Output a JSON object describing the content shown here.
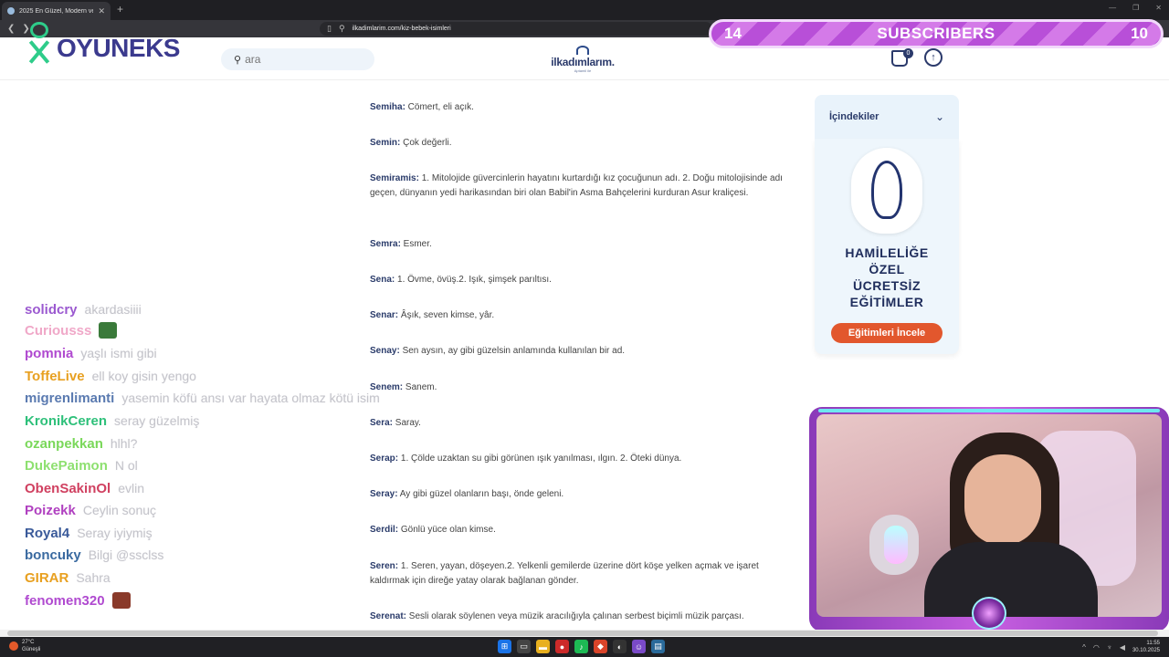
{
  "browser": {
    "tab_title": "2025 En Güzel, Modern ve Popüler",
    "tab_close": "✕",
    "new_tab": "+",
    "url": "ilkadimlarim.com/kiz-bebek-isimleri"
  },
  "site": {
    "search_placeholder": "ara",
    "brand_name": "ilkadımlarım.",
    "brand_sub": "Aptamil ile",
    "cart_count": "0"
  },
  "overlay": {
    "logo_text": "OYUNEKS",
    "subscribers": {
      "left": "14",
      "label": "SUBSCRIBERS",
      "right": "10"
    }
  },
  "article": {
    "entries": [
      {
        "name": "Semiha:",
        "text": " Cömert, eli açık."
      },
      {
        "name": "Semin:",
        "text": " Çok değerli."
      },
      {
        "name": "Semiramis:",
        "text": " 1. Mitolojide güvercinlerin hayatını kurtardığı kız çocuğunun adı. 2. Doğu mitolojisinde adı geçen, dünyanın yedi harikasından biri olan Babil'in Asma Bahçelerini kurduran Asur kraliçesi."
      },
      {
        "name": "Semra:",
        "text": " Esmer."
      },
      {
        "name": "Sena:",
        "text": " 1. Övme, övüş.2. Işık, şimşek parıltısı."
      },
      {
        "name": "Senar:",
        "text": " Âşık, seven kimse, yâr."
      },
      {
        "name": "Senay:",
        "text": " Sen aysın, ay gibi güzelsin anlamında kullanılan bir ad."
      },
      {
        "name": "Senem:",
        "text": " Sanem."
      },
      {
        "name": "Sera:",
        "text": " Saray."
      },
      {
        "name": "Serap:",
        "text": " 1. Çölde uzaktan su gibi görünen ışık yanılması, ılgın. 2. Öteki dünya."
      },
      {
        "name": "Seray:",
        "text": " Ay gibi güzel olanların başı, önde geleni."
      },
      {
        "name": "Serdil:",
        "text": " Gönlü yüce olan kimse."
      },
      {
        "name": "Seren:",
        "text": " 1. Seren, yayan, döşeyen.2. Yelkenli gemilerde üzerine dört köşe yelken açmak ve işaret kaldırmak için direğe yatay olarak bağlanan gönder."
      },
      {
        "name": "Serenat:",
        "text": " Sesli olarak söylenen veya müzik aracılığıyla çalınan serbest biçimli müzik parçası."
      }
    ]
  },
  "sidebar": {
    "toc_label": "İçindekiler",
    "ad_headline_1": "HAMİLELİĞE",
    "ad_headline_2": "ÖZEL",
    "ad_headline_3": "ÜCRETSİZ",
    "ad_headline_4": "EĞİTİMLER",
    "ad_cta": "Eğitimleri İncele"
  },
  "chat": {
    "messages": [
      {
        "user": "solidcry",
        "text": "akardasiiii",
        "color": "#9b59d0"
      },
      {
        "user": "Curiousss",
        "text": "",
        "color": "#f0a8c8",
        "emote": "#3a7a3a"
      },
      {
        "user": "pomnia",
        "text": "yaşlı ismi gibi",
        "color": "#b04ad0"
      },
      {
        "user": "ToffeLive",
        "text": "ell koy gisin yengo",
        "color": "#e8a020"
      },
      {
        "user": "migrenlimanti",
        "text": "yasemin köfü ansı var hayata olmaz kötü isim",
        "color": "#5a7ab0"
      },
      {
        "user": "KronikCeren",
        "text": "seray güzelmiş",
        "color": "#2ec07a"
      },
      {
        "user": "ozanpekkan",
        "text": "hlhl?",
        "color": "#7ad85a"
      },
      {
        "user": "DukePaimon",
        "text": "N ol",
        "color": "#8ee070"
      },
      {
        "user": "ObenSakinOl",
        "text": "evlin",
        "color": "#d04060"
      },
      {
        "user": "Poizekk",
        "text": "Ceylin sonuç",
        "color": "#b040c0"
      },
      {
        "user": "Royal4",
        "text": "Seray iyiymiş",
        "color": "#3a5a9a"
      },
      {
        "user": "boncuky",
        "text": "Bilgi @ssclss",
        "color": "#3a6aa0"
      },
      {
        "user": "GIRAR",
        "text": "Sahra",
        "color": "#e8a020"
      },
      {
        "user": "fenomen320",
        "text": "",
        "color": "#b04ad0",
        "emote": "#8a3a2a"
      }
    ]
  },
  "taskbar": {
    "weather_temp": "27°C",
    "weather_desc": "Güneşli",
    "time": "11:55",
    "date": "30.10.2025"
  }
}
